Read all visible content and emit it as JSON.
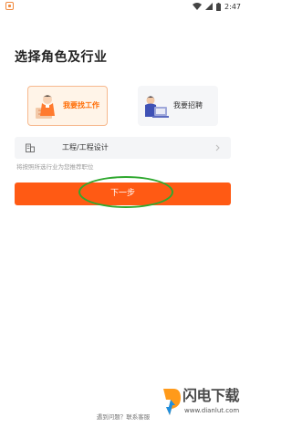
{
  "status_bar": {
    "time": "2:47",
    "icons": [
      "app-icon",
      "wifi-icon",
      "signal-icon",
      "battery-icon"
    ]
  },
  "page": {
    "title": "选择角色及行业"
  },
  "roles": {
    "seeker": {
      "label": "我要找工作",
      "icon": "job-seeker-illustration",
      "selected": true
    },
    "recruiter": {
      "label": "我要招聘",
      "icon": "recruiter-illustration",
      "selected": false
    }
  },
  "industry": {
    "value": "工程/工程设计",
    "icon": "building-icon"
  },
  "hint": "将按照所选行业为您推荐职位",
  "actions": {
    "next_label": "下一步"
  },
  "footer": {
    "contact": "遇到问题？联系客服"
  },
  "watermark": {
    "brand": "闪电下载",
    "url": "www.dianlut.com"
  },
  "colors": {
    "accent": "#ff5a14",
    "selected_card_bg": "#fff4e8",
    "annotation": "#2fa82f"
  }
}
